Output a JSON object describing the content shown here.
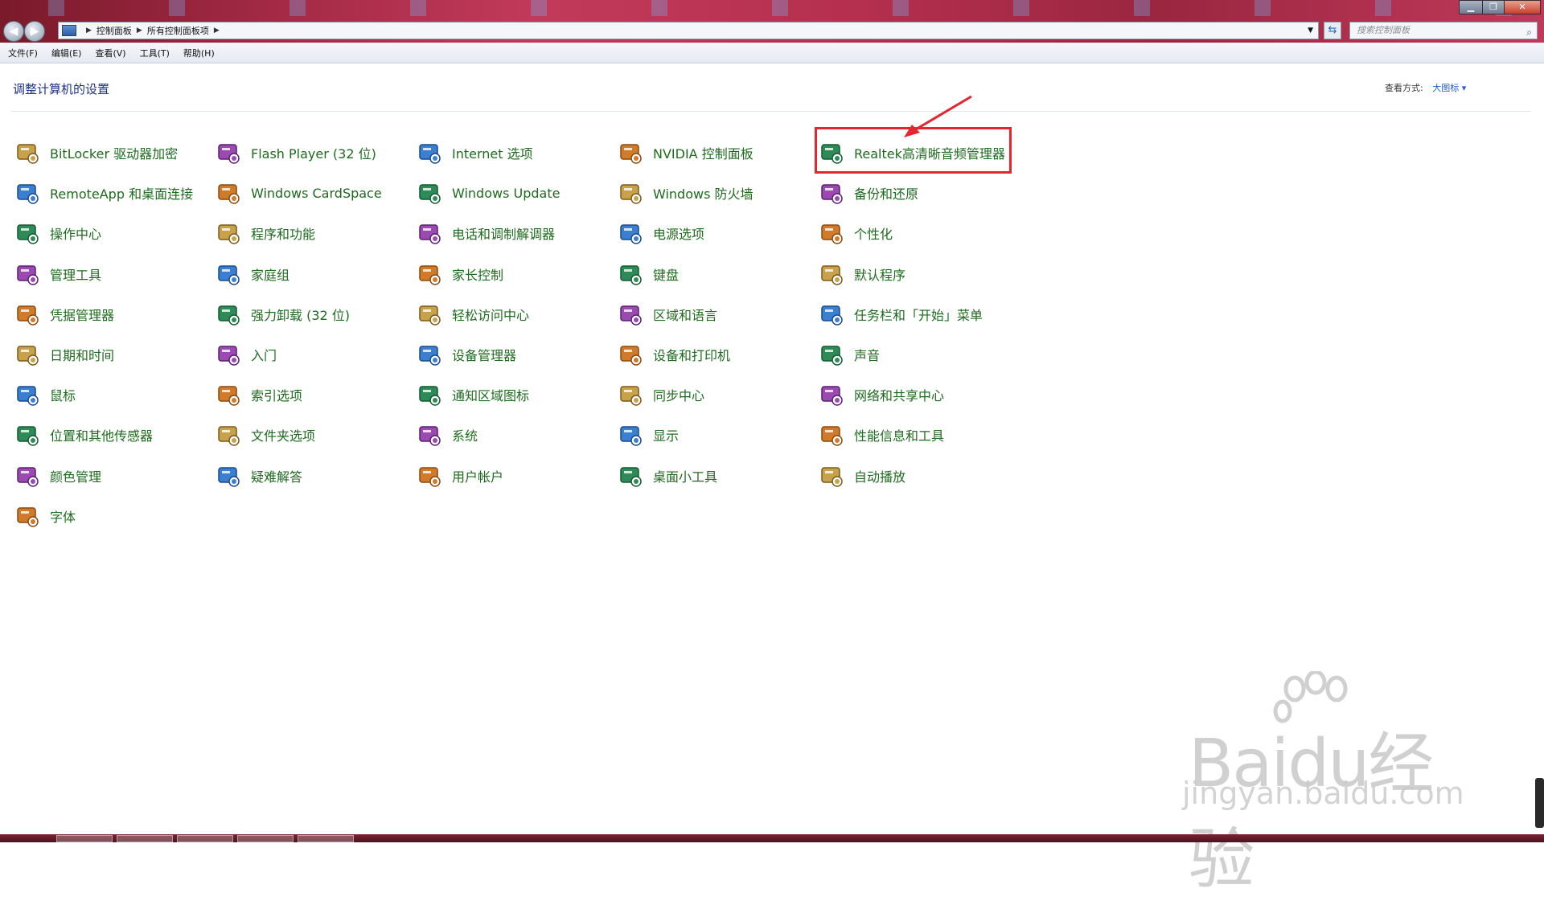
{
  "window": {
    "breadcrumbs": [
      "控制面板",
      "所有控制面板项"
    ],
    "search_placeholder": "搜索控制面板"
  },
  "menu": [
    "文件(F)",
    "编辑(E)",
    "查看(V)",
    "工具(T)",
    "帮助(H)"
  ],
  "header": {
    "title": "调整计算机的设置",
    "view_by_label": "查看方式:",
    "view_by_value": "大图标 ▾"
  },
  "items": [
    [
      "BitLocker 驱动器加密",
      "RemoteApp 和桌面连接",
      "操作中心",
      "管理工具",
      "凭据管理器",
      "日期和时间",
      "鼠标",
      "位置和其他传感器",
      "颜色管理",
      "字体"
    ],
    [
      "Flash Player (32 位)",
      "Windows CardSpace",
      "程序和功能",
      "家庭组",
      "强力卸载 (32 位)",
      "入门",
      "索引选项",
      "文件夹选项",
      "疑难解答"
    ],
    [
      "Internet 选项",
      "Windows Update",
      "电话和调制解调器",
      "家长控制",
      "轻松访问中心",
      "设备管理器",
      "通知区域图标",
      "系统",
      "用户帐户"
    ],
    [
      "NVIDIA 控制面板",
      "Windows 防火墙",
      "电源选项",
      "键盘",
      "区域和语言",
      "设备和打印机",
      "同步中心",
      "显示",
      "桌面小工具"
    ],
    [
      "Realtek高清晰音频管理器",
      "备份和还原",
      "个性化",
      "默认程序",
      "任务栏和「开始」菜单",
      "声音",
      "网络和共享中心",
      "性能信息和工具",
      "自动播放"
    ]
  ],
  "icons": [
    [
      "bitlocker-icon",
      "remoteapp-icon",
      "action-center-flag-icon",
      "admin-tools-icon",
      "credential-vault-icon",
      "calendar-clock-icon",
      "mouse-icon",
      "location-sensor-icon",
      "color-management-icon",
      "font-folder-icon"
    ],
    [
      "flash-player-icon",
      "cardspace-icon",
      "programs-icon",
      "homegroup-icon",
      "uninstaller-clover-icon",
      "getting-started-icon",
      "index-magnifier-icon",
      "folder-options-icon",
      "troubleshoot-icon"
    ],
    [
      "internet-options-icon",
      "windows-update-icon",
      "phone-modem-icon",
      "parental-controls-icon",
      "ease-of-access-icon",
      "device-manager-icon",
      "notification-tray-icon",
      "system-icon",
      "user-accounts-icon"
    ],
    [
      "nvidia-icon",
      "firewall-brick-icon",
      "power-options-icon",
      "keyboard-icon",
      "region-globe-icon",
      "devices-printers-icon",
      "sync-center-icon",
      "display-icon",
      "desktop-gadgets-icon"
    ],
    [
      "realtek-audio-icon",
      "backup-restore-icon",
      "personalization-icon",
      "default-programs-icon",
      "taskbar-start-icon",
      "sound-speaker-icon",
      "network-sharing-icon",
      "performance-icon",
      "autoplay-icon"
    ]
  ],
  "watermark": {
    "logo": "Baidu经验",
    "url": "jingyan.baidu.com"
  }
}
